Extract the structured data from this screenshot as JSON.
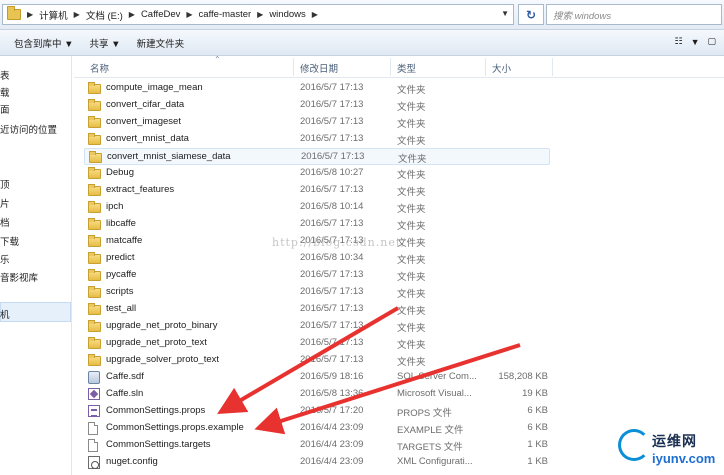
{
  "address": {
    "crumbs": [
      "计算机",
      "文档 (E:)",
      "CaffeDev",
      "caffe-master",
      "windows"
    ],
    "search_placeholder": "搜索 windows"
  },
  "toolbar": {
    "include_library": "包含到库中 ▼",
    "share": "共享 ▼",
    "new_folder": "新建文件夹"
  },
  "nav": {
    "items": [
      "表",
      "载",
      "面",
      "近访问的位置",
      "顶",
      "片",
      "档",
      "下载",
      "乐",
      "音影视库",
      "机"
    ]
  },
  "columns": {
    "name": "名称",
    "date": "修改日期",
    "type": "类型",
    "size": "大小"
  },
  "files": [
    {
      "icon": "folder-icon",
      "name": "compute_image_mean",
      "date": "2016/5/7 17:13",
      "type": "文件夹",
      "size": ""
    },
    {
      "icon": "folder-icon",
      "name": "convert_cifar_data",
      "date": "2016/5/7 17:13",
      "type": "文件夹",
      "size": ""
    },
    {
      "icon": "folder-icon",
      "name": "convert_imageset",
      "date": "2016/5/7 17:13",
      "type": "文件夹",
      "size": ""
    },
    {
      "icon": "folder-icon",
      "name": "convert_mnist_data",
      "date": "2016/5/7 17:13",
      "type": "文件夹",
      "size": ""
    },
    {
      "icon": "folder-icon",
      "name": "convert_mnist_siamese_data",
      "date": "2016/5/7 17:13",
      "type": "文件夹",
      "size": ""
    },
    {
      "icon": "folder-icon",
      "name": "Debug",
      "date": "2016/5/8 10:27",
      "type": "文件夹",
      "size": ""
    },
    {
      "icon": "folder-icon",
      "name": "extract_features",
      "date": "2016/5/7 17:13",
      "type": "文件夹",
      "size": ""
    },
    {
      "icon": "folder-icon",
      "name": "ipch",
      "date": "2016/5/8 10:14",
      "type": "文件夹",
      "size": ""
    },
    {
      "icon": "folder-icon",
      "name": "libcaffe",
      "date": "2016/5/7 17:13",
      "type": "文件夹",
      "size": ""
    },
    {
      "icon": "folder-icon",
      "name": "matcaffe",
      "date": "2016/5/7 17:13",
      "type": "文件夹",
      "size": ""
    },
    {
      "icon": "folder-icon",
      "name": "predict",
      "date": "2016/5/8 10:34",
      "type": "文件夹",
      "size": ""
    },
    {
      "icon": "folder-icon",
      "name": "pycaffe",
      "date": "2016/5/7 17:13",
      "type": "文件夹",
      "size": ""
    },
    {
      "icon": "folder-icon",
      "name": "scripts",
      "date": "2016/5/7 17:13",
      "type": "文件夹",
      "size": ""
    },
    {
      "icon": "folder-icon",
      "name": "test_all",
      "date": "2016/5/7 17:13",
      "type": "文件夹",
      "size": ""
    },
    {
      "icon": "folder-icon",
      "name": "upgrade_net_proto_binary",
      "date": "2016/5/7 17:13",
      "type": "文件夹",
      "size": ""
    },
    {
      "icon": "folder-icon",
      "name": "upgrade_net_proto_text",
      "date": "2016/5/7 17:13",
      "type": "文件夹",
      "size": ""
    },
    {
      "icon": "folder-icon",
      "name": "upgrade_solver_proto_text",
      "date": "2016/5/7 17:13",
      "type": "文件夹",
      "size": ""
    },
    {
      "icon": "database-file-icon",
      "name": "Caffe.sdf",
      "date": "2016/5/9 18:16",
      "type": "SQL Server Com...",
      "size": "158,208 KB"
    },
    {
      "icon": "solution-file-icon",
      "name": "Caffe.sln",
      "date": "2016/5/8 13:36",
      "type": "Microsoft Visual...",
      "size": "19 KB"
    },
    {
      "icon": "props-file-icon",
      "name": "CommonSettings.props",
      "date": "2016/5/7 17:20",
      "type": "PROPS 文件",
      "size": "6 KB"
    },
    {
      "icon": "document-icon",
      "name": "CommonSettings.props.example",
      "date": "2016/4/4 23:09",
      "type": "EXAMPLE 文件",
      "size": "6 KB"
    },
    {
      "icon": "document-icon",
      "name": "CommonSettings.targets",
      "date": "2016/4/4 23:09",
      "type": "TARGETS 文件",
      "size": "1 KB"
    },
    {
      "icon": "config-file-icon",
      "name": "nuget.config",
      "date": "2016/4/4 23:09",
      "type": "XML Configurati...",
      "size": "1 KB"
    }
  ],
  "watermark": "http://blog.csdn.net/",
  "logo": {
    "cn": "运维网",
    "en": "iyunv.com"
  },
  "colors": {
    "arrow": "#e8322f",
    "folder": "#e6bd45",
    "accent": "#1d6fd1"
  }
}
